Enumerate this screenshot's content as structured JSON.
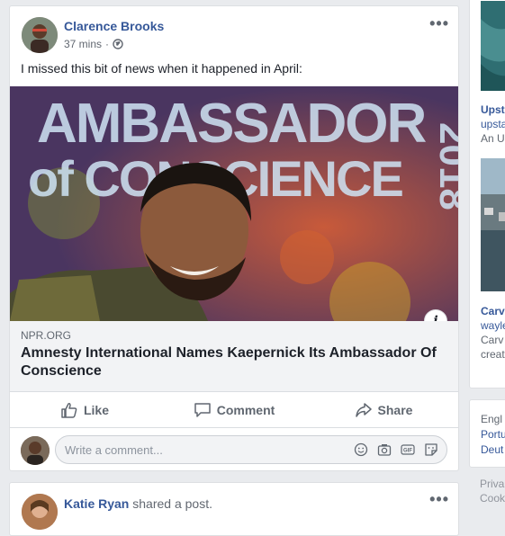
{
  "post": {
    "author": "Clarence Brooks",
    "timestamp": "37 mins",
    "privacy_icon": "globe-icon",
    "more_label": "•••",
    "text": "I missed this bit of news when it happened in April:",
    "link": {
      "image_banner_text": "AMBASSADOR OF CONSCIENCE 2018",
      "info_label": "i",
      "domain": "NPR.ORG",
      "title": "Amnesty International Names Kaepernick Its Ambassador Of Conscience"
    },
    "actions": [
      {
        "label": "Like",
        "icon": "thumbs-up-icon"
      },
      {
        "label": "Comment",
        "icon": "speech-bubble-icon"
      },
      {
        "label": "Share",
        "icon": "share-arrow-icon"
      }
    ],
    "comment_placeholder": "Write a comment...",
    "comment_icons": [
      "emoji-icon",
      "camera-icon",
      "gif-icon",
      "sticker-icon"
    ]
  },
  "post2": {
    "author": "Katie Ryan",
    "action": "shared a post.",
    "more_label": "•••"
  },
  "right_column": {
    "story1": {
      "title": "Upst",
      "link": "upsta",
      "line": "An U"
    },
    "story2": {
      "title": "Carv",
      "link": "wayle",
      "line1": "Carv",
      "line2": "creat"
    },
    "languages": [
      "Engl",
      "Portu",
      "Deut"
    ],
    "footer": [
      "Priva",
      "Cook"
    ]
  },
  "colors": {
    "link_blue": "#365899",
    "background": "#e9ebee",
    "caption_bg": "#f2f3f5"
  }
}
